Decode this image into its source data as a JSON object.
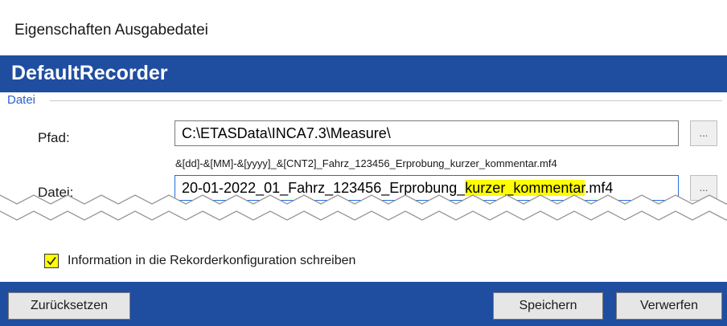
{
  "window": {
    "title": "Eigenschaften Ausgabedatei"
  },
  "banner": {
    "title": "DefaultRecorder"
  },
  "group": {
    "label": "Datei"
  },
  "path": {
    "label": "Pfad:",
    "value": "C:\\ETASData\\INCA7.3\\Measure\\",
    "browse_label": "..."
  },
  "file": {
    "pattern": "&[dd]-&[MM]-&[yyyy]_&[CNT2]_Fahrz_123456_Erprobung_kurzer_kommentar.mf4",
    "label": "Datei:",
    "value_prefix": "20-01-2022_01_Fahrz_123456_Erprobung_",
    "value_highlight": "kurzer_kommentar",
    "value_suffix": ".mf4",
    "highlight_color": "#ffff00",
    "browse_label": "..."
  },
  "option": {
    "label": "Information in die Rekorderkonfiguration schreiben",
    "checked": true
  },
  "buttons": {
    "reset": "Zurücksetzen",
    "save": "Speichern",
    "discard": "Verwerfen"
  },
  "colors": {
    "accent": "#1f4ea0",
    "group_label": "#2b63c9",
    "highlight": "#ffff00"
  }
}
